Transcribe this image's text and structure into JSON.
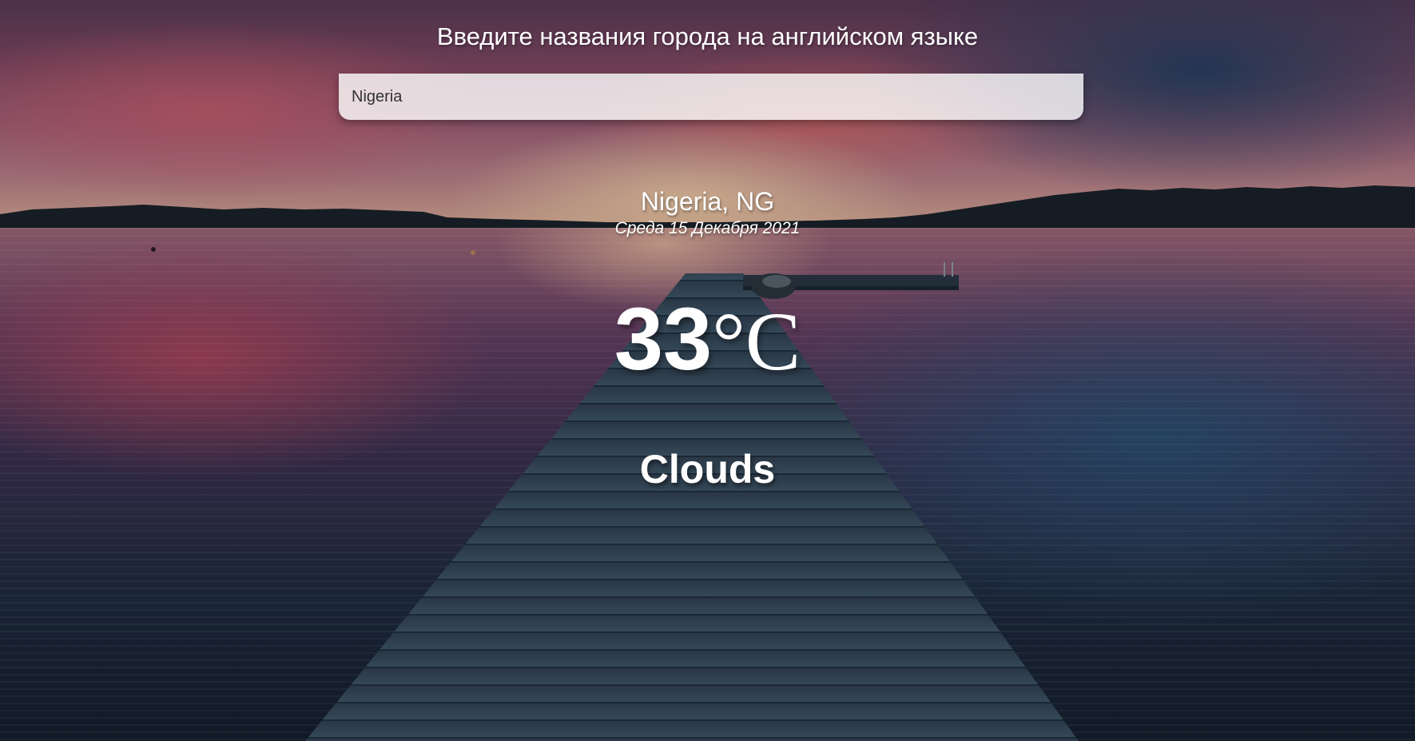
{
  "search": {
    "prompt": "Введите названия города на английском языке",
    "value": "Nigeria"
  },
  "location": {
    "city_country": "Nigeria, NG",
    "date": "Среда 15 Декабря 2021"
  },
  "weather": {
    "temperature": "33",
    "unit": "°C",
    "condition": "Clouds"
  }
}
